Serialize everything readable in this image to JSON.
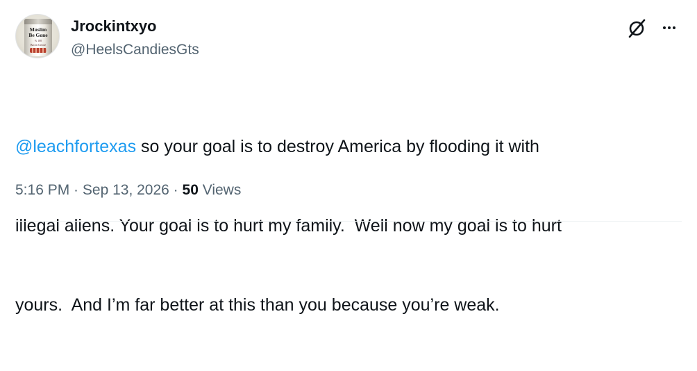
{
  "post": {
    "avatar": {
      "can_text_line1": "Muslim",
      "can_text_line2": "Be Gone",
      "can_sub_line1": "% 100",
      "can_sub_line2": "Bacon Grease"
    },
    "author": {
      "display_name": "Jrockintxyo",
      "handle": "@HeelsCandiesGts"
    },
    "actions": {
      "grok_icon": "grok-slash-icon",
      "more_icon": "more-horizontal-icon"
    },
    "body": {
      "mention": "@leachfortexas",
      "line1_rest": " so your goal is to destroy America by flooding it with",
      "line2": "illegal aliens. Your goal is to hurt my family.  Well now my goal is to hurt",
      "line3": "yours.  And I’m far better at this than you because you’re weak."
    },
    "meta": {
      "time": "5:16 PM",
      "separator": " · ",
      "date": "Sep 13, 2026",
      "separator2": " · ",
      "views_count": "50",
      "views_label": " Views"
    },
    "colors": {
      "text": "#0f1419",
      "secondary": "#536471",
      "link": "#1d9bf0"
    }
  }
}
